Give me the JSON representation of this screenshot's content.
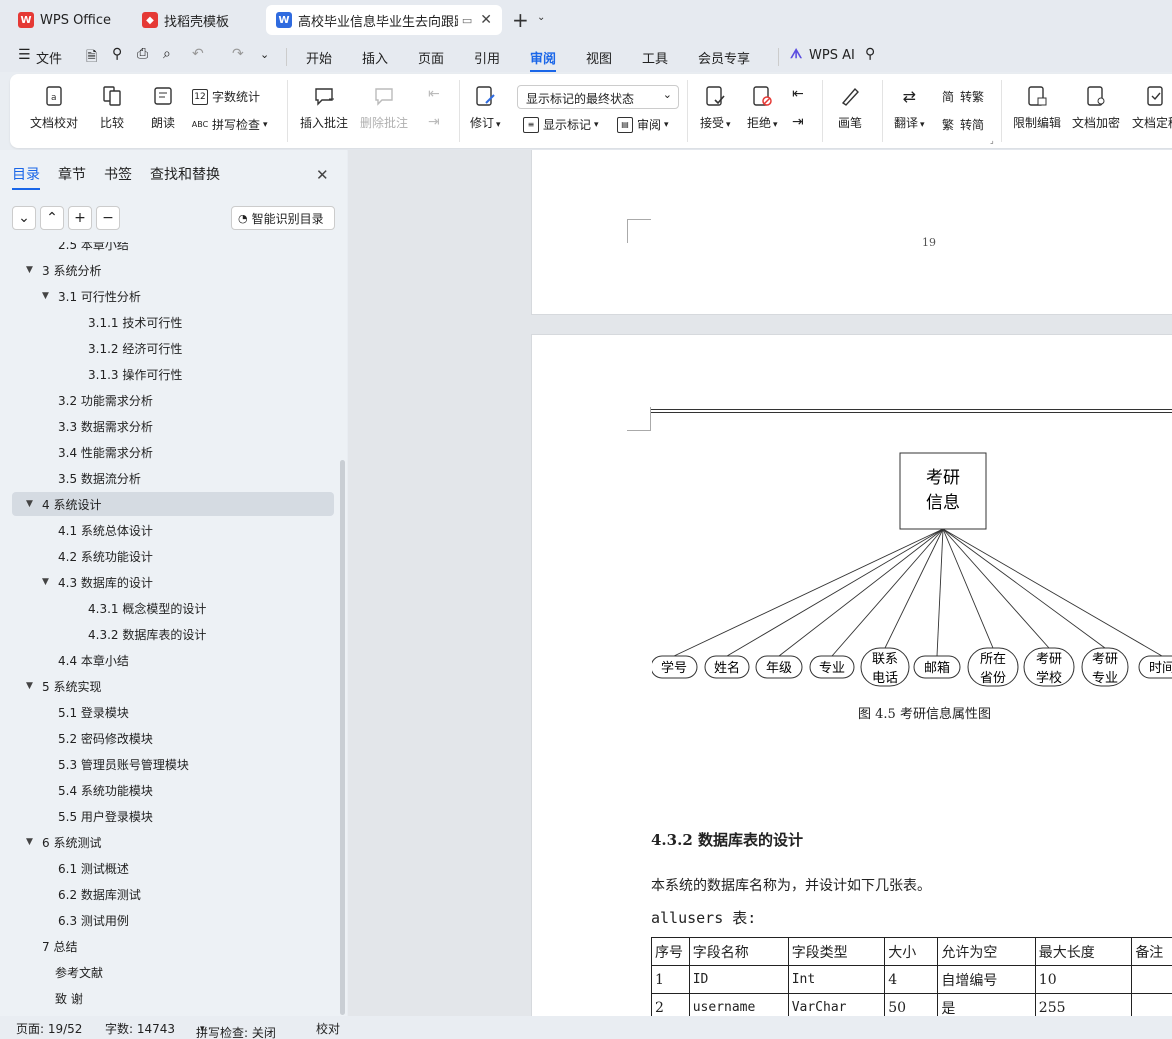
{
  "tabs": [
    {
      "label": "WPS Office"
    },
    {
      "label": "找稻壳模板"
    },
    {
      "label": "高校毕业信息毕业生去向跟踪系统"
    }
  ],
  "menu": {
    "file": "文件",
    "items": [
      "开始",
      "插入",
      "页面",
      "引用",
      "审阅",
      "视图",
      "工具",
      "会员专享"
    ],
    "active": "审阅",
    "wps_ai": "WPS AI"
  },
  "ribbon": {
    "doc_check": "文档校对",
    "compare": "比较",
    "read": "朗读",
    "word_count": "字数统计",
    "spell_check": "拼写检查",
    "insert_comment": "插入批注",
    "delete_comment": "删除批注",
    "revise": "修订",
    "markup_select": "显示标记的最终状态",
    "show_markup": "显示标记",
    "review": "审阅",
    "accept": "接受",
    "reject": "拒绝",
    "pen": "画笔",
    "translate": "翻译",
    "to_trad": "转繁",
    "to_simp": "转简",
    "restrict_edit": "限制编辑",
    "encrypt": "文档加密",
    "finalize": "文档定稿"
  },
  "sidebar": {
    "tabs": [
      "目录",
      "章节",
      "书签",
      "查找和替换"
    ],
    "smart_toc": "智能识别目录",
    "toc": [
      {
        "label": "2.5 本章小结",
        "level": 2
      },
      {
        "label": "3  系统分析",
        "level": 1,
        "expanded": true
      },
      {
        "label": "3.1 可行性分析",
        "level": 2,
        "expanded": true
      },
      {
        "label": "3.1.1  技术可行性",
        "level": 3
      },
      {
        "label": "3.1.2  经济可行性",
        "level": 3
      },
      {
        "label": "3.1.3  操作可行性",
        "level": 3
      },
      {
        "label": "3.2  功能需求分析",
        "level": 2
      },
      {
        "label": "3.3  数据需求分析",
        "level": 2
      },
      {
        "label": "3.4  性能需求分析",
        "level": 2
      },
      {
        "label": "3.5 数据流分析",
        "level": 2
      },
      {
        "label": "4   系统设计",
        "level": 1,
        "expanded": true,
        "selected": true
      },
      {
        "label": "4.1 系统总体设计",
        "level": 2
      },
      {
        "label": "4.2 系统功能设计",
        "level": 2
      },
      {
        "label": "4.3  数据库的设计",
        "level": 2,
        "expanded": true
      },
      {
        "label": "4.3.1  概念模型的设计",
        "level": 3
      },
      {
        "label": "4.3.2  数据库表的设计",
        "level": 3
      },
      {
        "label": "4.4 本章小结",
        "level": 2
      },
      {
        "label": "5   系统实现",
        "level": 1,
        "expanded": true
      },
      {
        "label": "5.1 登录模块",
        "level": 2
      },
      {
        "label": "5.2 密码修改模块",
        "level": 2
      },
      {
        "label": "5.3 管理员账号管理模块",
        "level": 2
      },
      {
        "label": "5.4 系统功能模块",
        "level": 2
      },
      {
        "label": "5.5 用户登录模块",
        "level": 2
      },
      {
        "label": "6   系统测试",
        "level": 1,
        "expanded": true
      },
      {
        "label": "6.1 测试概述",
        "level": 2
      },
      {
        "label": "6.2 数据库测试",
        "level": 2
      },
      {
        "label": "6.3 测试用例",
        "level": 2
      },
      {
        "label": "7   总结",
        "level": 1
      },
      {
        "label": "参考文献",
        "level": 0
      },
      {
        "label": "致  谢",
        "level": 0
      }
    ]
  },
  "document": {
    "page_number": "19",
    "entity_line1": "考研",
    "entity_line2": "信息",
    "attributes": [
      [
        "学号"
      ],
      [
        "姓名"
      ],
      [
        "年级"
      ],
      [
        "专业"
      ],
      [
        "联系",
        "电话"
      ],
      [
        "邮箱"
      ],
      [
        "所在",
        "省份"
      ],
      [
        "考研",
        "学校"
      ],
      [
        "考研",
        "专业"
      ],
      [
        "时间"
      ]
    ],
    "figure_caption": "图 4.5  考研信息属性图",
    "heading": "4.3.2  数据库表的设计",
    "paragraph": "本系统的数据库名称为，并设计如下几张表。",
    "table_title": "allusers 表:",
    "table": {
      "headers": [
        "序号",
        "字段名称",
        "字段类型",
        "大小",
        "允许为空",
        "最大长度",
        "备注"
      ],
      "rows": [
        [
          "1",
          "ID",
          "Int",
          "4",
          "自增编号",
          "10",
          ""
        ],
        [
          "2",
          "username",
          "VarChar",
          "50",
          "是",
          "255",
          ""
        ]
      ]
    }
  },
  "status": {
    "page": "页面: 19/52",
    "words": "字数: 14743",
    "spell": "拼写检查: 关闭",
    "proof": "校对"
  }
}
